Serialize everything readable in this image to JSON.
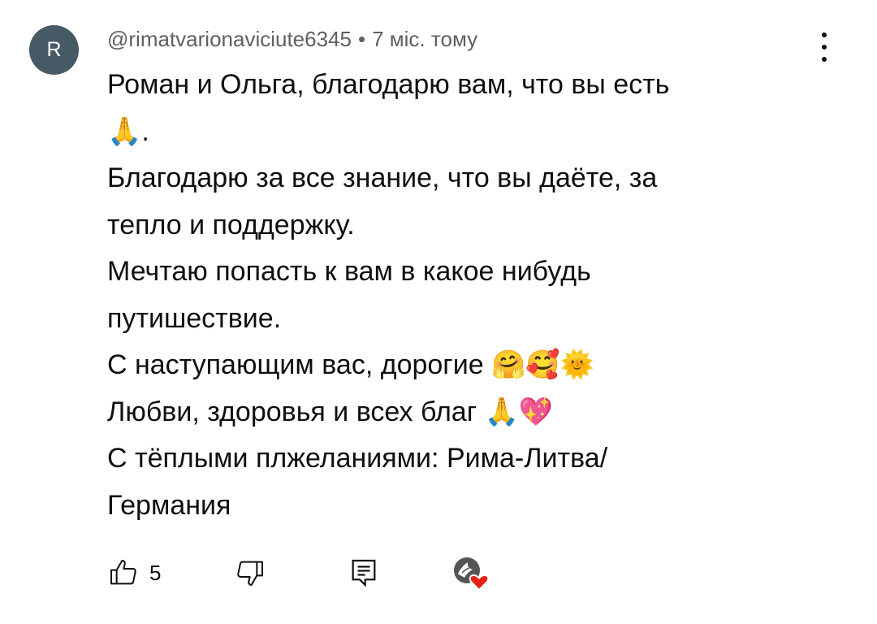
{
  "comment": {
    "avatar_letter": "R",
    "author": "@rimatvarionaviciute6345",
    "separator": "•",
    "time_ago": "7 міс. тому",
    "lines": [
      "Роман и Ольга, благодарю вам, что вы есть",
      "🙏.",
      "Благодарю за все знание, что вы даёте, за",
      "тепло и поддержку.",
      "Мечтаю попасть к вам в какое нибудь",
      "путишествие.",
      "С наступающим вас, дорогие 🤗🥰🌞",
      "Любви, здоровья и всех благ 🙏💖",
      "С тёплыми плжеланиями: Рима-Литва/",
      "Германия"
    ]
  },
  "actions": {
    "like_count": "5",
    "icons": {
      "more": "more-vertical-icon",
      "like": "thumbs-up-icon",
      "dislike": "thumbs-down-icon",
      "reply": "reply-comment-icon",
      "creator_heart": "creator-heart-icon"
    }
  },
  "colors": {
    "avatar_bg": "#455a64",
    "meta_text": "#606060",
    "text": "#0f0f0f",
    "heart": "#e62117"
  }
}
